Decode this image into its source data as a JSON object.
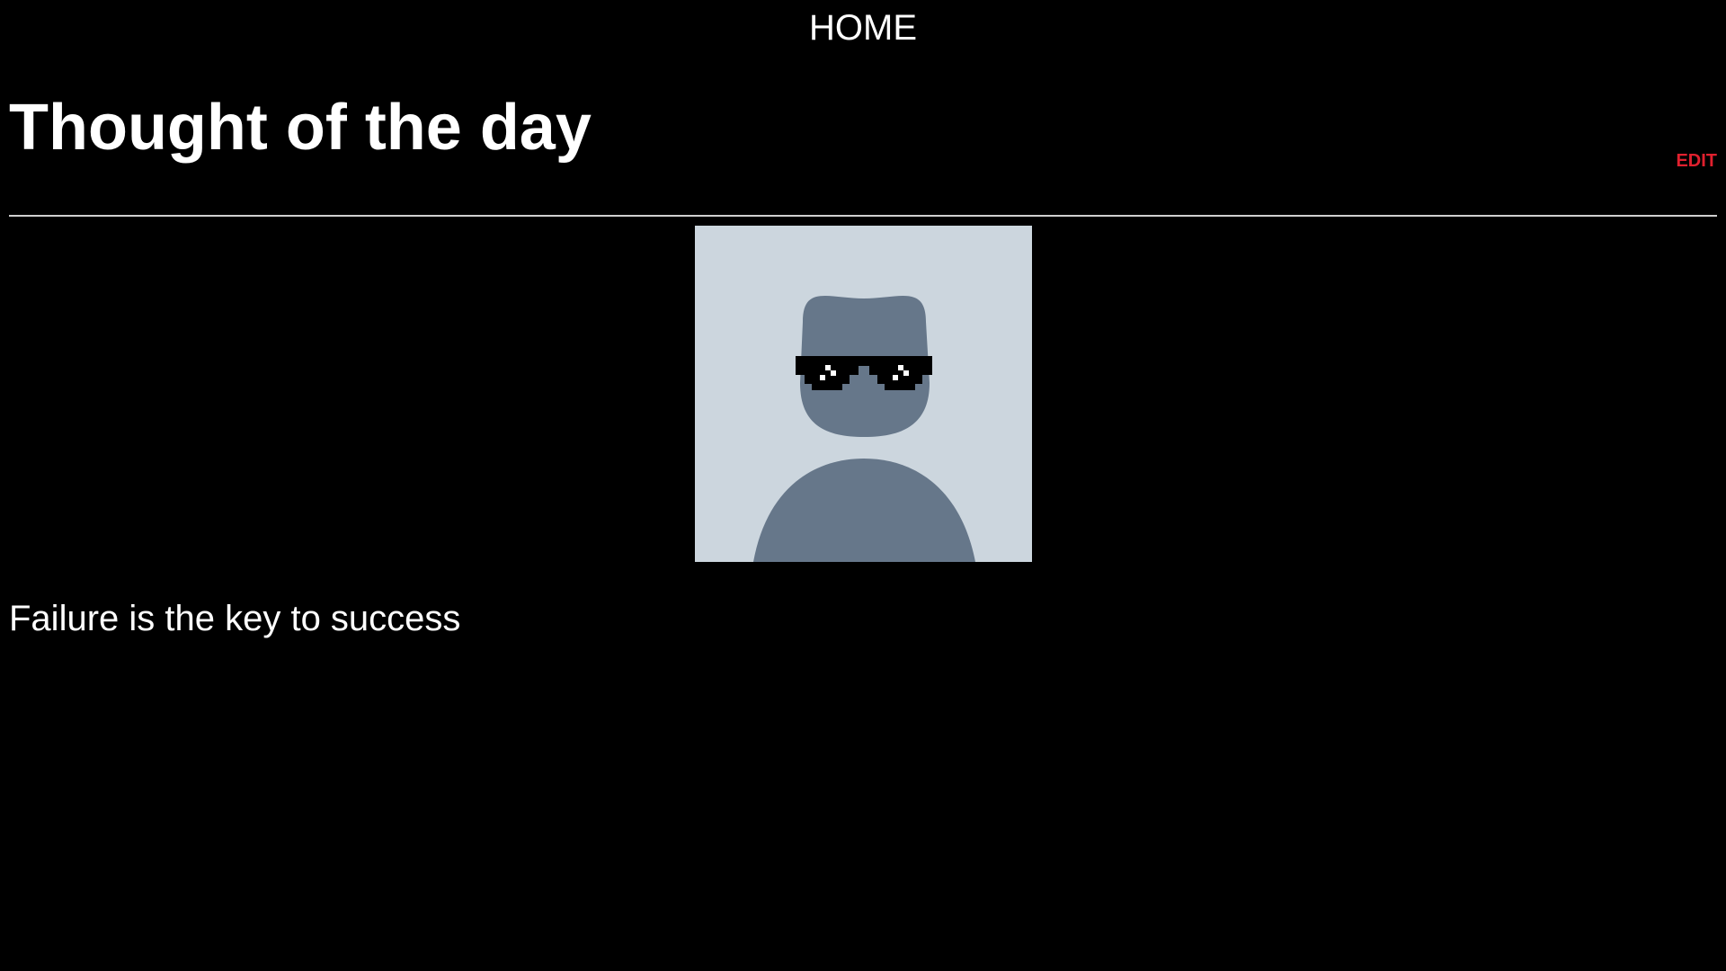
{
  "nav": {
    "home_label": "HOME"
  },
  "header": {
    "title": "Thought of the day",
    "edit_label": "EDIT"
  },
  "post": {
    "image_icon": "avatar-with-sunglasses-icon",
    "text": "Failure is the key to success"
  },
  "colors": {
    "background": "#000000",
    "text": "#ffffff",
    "edit": "#e0202e",
    "avatar_background": "#ccd6de",
    "avatar_figure": "#66778a"
  }
}
